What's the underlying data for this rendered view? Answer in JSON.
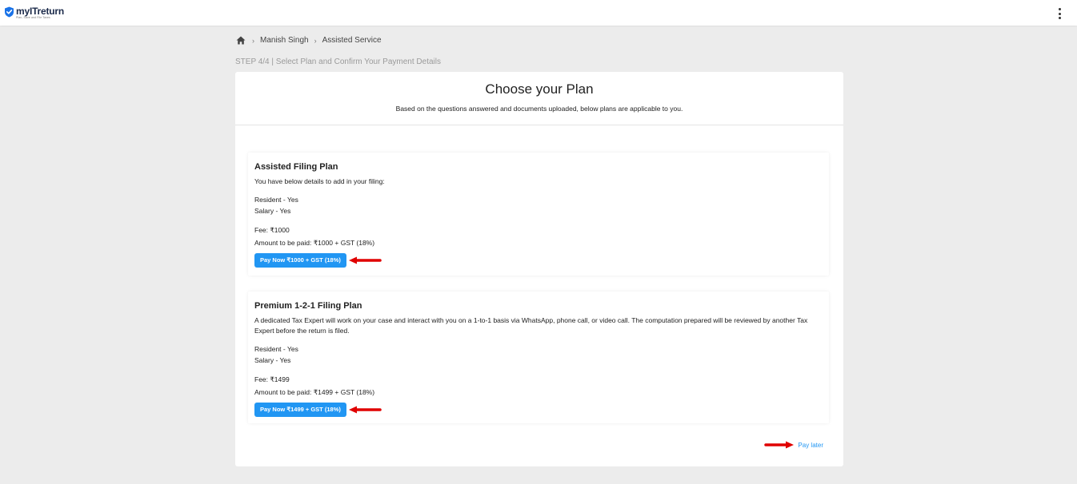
{
  "app": {
    "name": "myITreturn",
    "tagline": "Plan, Save and File Taxes"
  },
  "breadcrumb": {
    "items": [
      "Manish Singh",
      "Assisted Service"
    ]
  },
  "step_text": "STEP 4/4 | Select Plan and Confirm Your Payment Details",
  "card": {
    "title": "Choose your Plan",
    "subtitle": "Based on the questions answered and documents uploaded, below plans are applicable to you."
  },
  "plans": [
    {
      "title": "Assisted Filing Plan",
      "description": "You have below details to add in your filing:",
      "details": [
        "Resident - Yes",
        "Salary - Yes"
      ],
      "fee": "Fee: ₹1000",
      "amount": "Amount to be paid: ₹1000 + GST (18%)",
      "button": "Pay Now ₹1000 + GST (18%)"
    },
    {
      "title": "Premium 1-2-1 Filing Plan",
      "description": "A dedicated Tax Expert will work on your case and interact with you on a 1-to-1 basis via WhatsApp, phone call, or video call. The computation prepared will be reviewed by another Tax Expert before the return is filed.",
      "details": [
        "Resident - Yes",
        "Salary - Yes"
      ],
      "fee": "Fee: ₹1499",
      "amount": "Amount to be paid: ₹1499 + GST (18%)",
      "button": "Pay Now ₹1499 + GST (18%)"
    }
  ],
  "pay_later": "Pay later",
  "colors": {
    "accent": "#2196f3",
    "annotation_arrow": "#e00000",
    "background": "#ececec"
  },
  "icons": {
    "logo": "shield-check-icon",
    "home": "home-icon",
    "menu": "kebab-menu-icon",
    "annotation": "red-arrow-icon"
  }
}
